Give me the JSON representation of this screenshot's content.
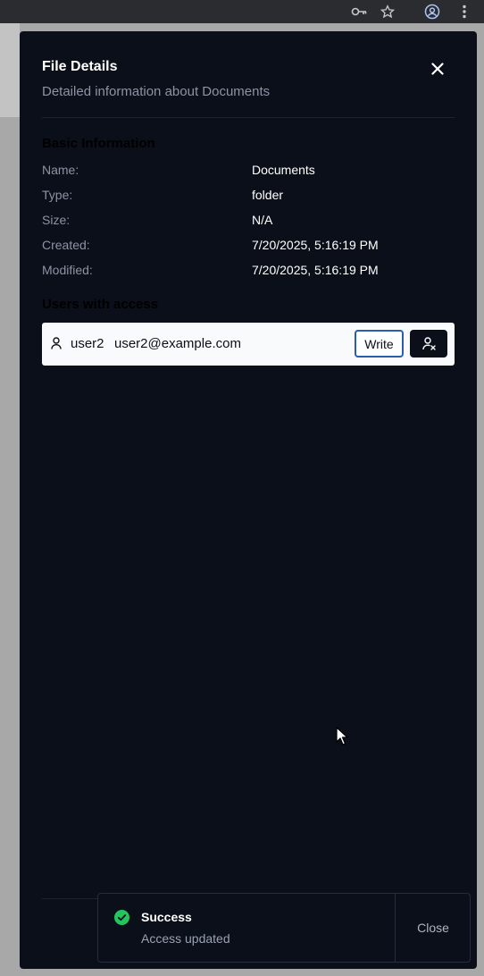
{
  "browser": {
    "icons": [
      "key-icon",
      "star-icon",
      "profile-icon",
      "more-vert-icon"
    ]
  },
  "dialog": {
    "title": "File Details",
    "subtitle": "Detailed information about Documents",
    "close_icon": "close-icon",
    "basic_section": {
      "title": "Basic Information",
      "rows": [
        {
          "label": "Name:",
          "value": "Documents"
        },
        {
          "label": "Type:",
          "value": "folder"
        },
        {
          "label": "Size:",
          "value": "N/A"
        },
        {
          "label": "Created:",
          "value": "7/20/2025, 5:16:19 PM"
        },
        {
          "label": "Modified:",
          "value": "7/20/2025, 5:16:19 PM"
        }
      ]
    },
    "access_section": {
      "title": "Users with access",
      "users": [
        {
          "username": "user2",
          "email": "user2@example.com",
          "permission": "Write",
          "remove_icon": "user-remove-icon"
        }
      ]
    }
  },
  "toast": {
    "title": "Success",
    "description": "Access updated",
    "close_label": "Close",
    "status_color": "#22c55e"
  },
  "colors": {
    "panel_bg": "#0b0f19",
    "accent_border": "#2a5db0"
  }
}
